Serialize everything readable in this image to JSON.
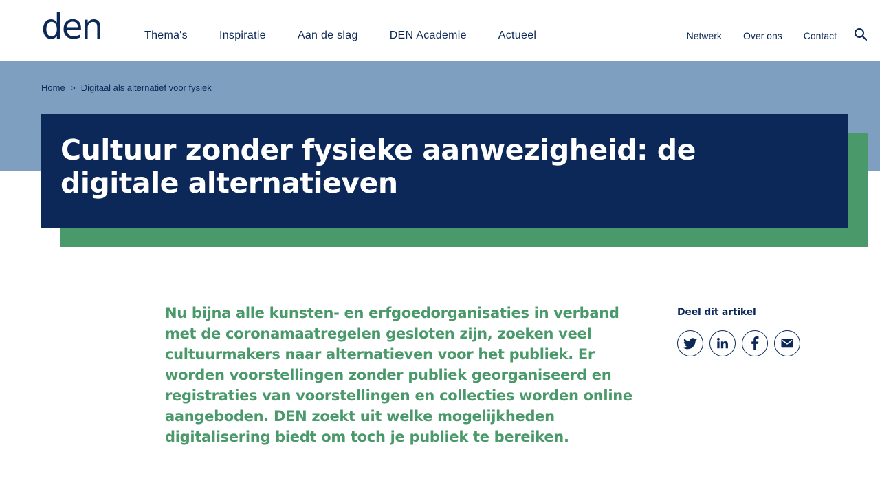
{
  "header": {
    "logo_text": "den",
    "main_nav": [
      "Thema's",
      "Inspiratie",
      "Aan de slag",
      "DEN Academie",
      "Actueel"
    ],
    "util_nav": [
      "Netwerk",
      "Over ons",
      "Contact"
    ],
    "search_icon": "search-icon"
  },
  "breadcrumb": {
    "home": "Home",
    "separator": ">",
    "current": "Digitaal als alternatief voor fysiek"
  },
  "hero": {
    "title": "Cultuur zonder fysieke aanwezigheid: de digitale alternatieven"
  },
  "intro": {
    "text": "Nu bijna alle kunsten- en erfgoedorganisaties in verband met de coronamaatregelen gesloten zijn, zoeken veel cultuurmakers naar alternatieven voor het publiek. Er worden voorstellingen zonder publiek georganiseerd en registraties van voorstellingen en collecties worden online aangeboden. DEN zoekt uit welke mogelijkheden digitalisering biedt om toch je publiek te bereiken."
  },
  "share": {
    "label": "Deel dit artikel",
    "icons": [
      "twitter-icon",
      "linkedin-icon",
      "facebook-icon",
      "mail-icon"
    ]
  },
  "colors": {
    "navy": "#0b2858",
    "band_blue": "#7e9fbf",
    "green": "#4a996a",
    "white": "#ffffff"
  }
}
